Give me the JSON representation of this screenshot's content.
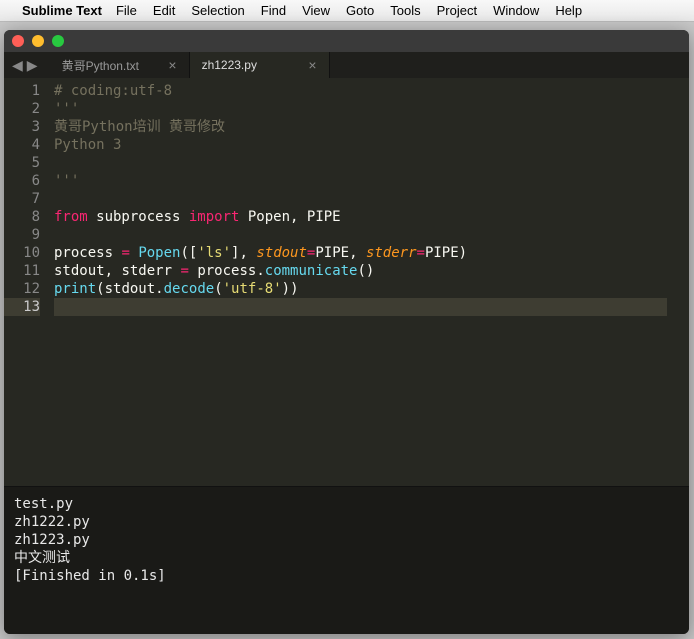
{
  "menubar": {
    "appname": "Sublime Text",
    "items": [
      "File",
      "Edit",
      "Selection",
      "Find",
      "View",
      "Goto",
      "Tools",
      "Project",
      "Window",
      "Help"
    ]
  },
  "tabs": [
    {
      "label": "黄哥Python.txt",
      "active": false
    },
    {
      "label": "zh1223.py",
      "active": true
    }
  ],
  "code": {
    "lines": [
      {
        "n": "1",
        "tokens": [
          [
            "c-comment",
            "# coding:utf-8"
          ]
        ]
      },
      {
        "n": "2",
        "tokens": [
          [
            "c-comment",
            "'''"
          ]
        ]
      },
      {
        "n": "3",
        "tokens": [
          [
            "c-comment",
            "黄哥Python培训 黄哥修改"
          ]
        ]
      },
      {
        "n": "4",
        "tokens": [
          [
            "c-comment",
            "Python 3"
          ]
        ]
      },
      {
        "n": "5",
        "tokens": []
      },
      {
        "n": "6",
        "tokens": [
          [
            "c-comment",
            "'''"
          ]
        ]
      },
      {
        "n": "7",
        "tokens": []
      },
      {
        "n": "8",
        "tokens": [
          [
            "c-keyword",
            "from"
          ],
          [
            "c-name",
            " subprocess "
          ],
          [
            "c-keyword",
            "import"
          ],
          [
            "c-name",
            " Popen"
          ],
          [
            "c-punct",
            ", "
          ],
          [
            "c-name",
            "PIPE"
          ]
        ]
      },
      {
        "n": "9",
        "tokens": []
      },
      {
        "n": "10",
        "tokens": [
          [
            "c-name",
            "process "
          ],
          [
            "c-keyword",
            "="
          ],
          [
            "c-name",
            " "
          ],
          [
            "c-call",
            "Popen"
          ],
          [
            "c-punct",
            "(["
          ],
          [
            "c-string",
            "'ls'"
          ],
          [
            "c-punct",
            "], "
          ],
          [
            "c-param",
            "stdout"
          ],
          [
            "c-keyword",
            "="
          ],
          [
            "c-name",
            "PIPE"
          ],
          [
            "c-punct",
            ", "
          ],
          [
            "c-param",
            "stderr"
          ],
          [
            "c-keyword",
            "="
          ],
          [
            "c-name",
            "PIPE"
          ],
          [
            "c-punct",
            ")"
          ]
        ]
      },
      {
        "n": "11",
        "tokens": [
          [
            "c-name",
            "stdout"
          ],
          [
            "c-punct",
            ", "
          ],
          [
            "c-name",
            "stderr "
          ],
          [
            "c-keyword",
            "="
          ],
          [
            "c-name",
            " process"
          ],
          [
            "c-punct",
            "."
          ],
          [
            "c-call",
            "communicate"
          ],
          [
            "c-punct",
            "()"
          ]
        ]
      },
      {
        "n": "12",
        "tokens": [
          [
            "c-call",
            "print"
          ],
          [
            "c-punct",
            "("
          ],
          [
            "c-name",
            "stdout"
          ],
          [
            "c-punct",
            "."
          ],
          [
            "c-call",
            "decode"
          ],
          [
            "c-punct",
            "("
          ],
          [
            "c-string",
            "'utf-8'"
          ],
          [
            "c-punct",
            "))"
          ]
        ]
      },
      {
        "n": "13",
        "tokens": [],
        "current": true
      }
    ]
  },
  "console": {
    "lines": [
      "test.py",
      "zh1222.py",
      "zh1223.py",
      "中文测试",
      "",
      "[Finished in 0.1s]"
    ]
  }
}
